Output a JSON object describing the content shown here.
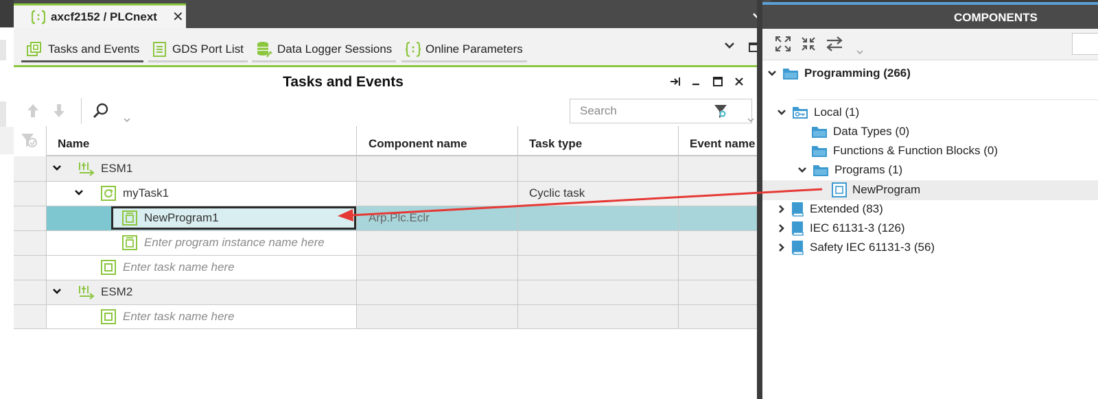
{
  "doc_tab": {
    "title": "axcf2152 / PLCnext",
    "close": "✕"
  },
  "subtabs": [
    {
      "label": "Tasks and Events"
    },
    {
      "label": "GDS Port List"
    },
    {
      "label": "Data Logger Sessions"
    },
    {
      "label": "Online Parameters"
    }
  ],
  "panel": {
    "title": "Tasks and Events"
  },
  "search": {
    "placeholder": "Search"
  },
  "table": {
    "columns": [
      "Name",
      "Component name",
      "Task type",
      "Event name"
    ],
    "rows": [
      {
        "name": "ESM1",
        "component": "",
        "task_type": "",
        "event": ""
      },
      {
        "name": "myTask1",
        "component": "",
        "task_type": "Cyclic task",
        "event": ""
      },
      {
        "name": "NewProgram1",
        "component": "Arp.Plc.Eclr",
        "task_type": "",
        "event": ""
      },
      {
        "name": "Enter program instance name here",
        "component": "",
        "task_type": "",
        "event": ""
      },
      {
        "name": "Enter task name here",
        "component": "",
        "task_type": "",
        "event": ""
      },
      {
        "name": "ESM2",
        "component": "",
        "task_type": "",
        "event": ""
      },
      {
        "name": "Enter task name here",
        "component": "",
        "task_type": "",
        "event": ""
      }
    ]
  },
  "components": {
    "header": "COMPONENTS",
    "tree": [
      {
        "label": "Programming (266)"
      },
      {
        "label": "Local (1)"
      },
      {
        "label": "Data Types (0)"
      },
      {
        "label": "Functions & Function Blocks (0)"
      },
      {
        "label": "Programs (1)"
      },
      {
        "label": "NewProgram"
      },
      {
        "label": "Extended (83)"
      },
      {
        "label": "IEC 61131-3 (126)"
      },
      {
        "label": "Safety IEC 61131-3 (56)"
      }
    ]
  },
  "colors": {
    "accent_green": "#8cc63f",
    "selected_row": "#a8d5da",
    "arrow": "#e53935",
    "folder_blue": "#3d9ad1"
  }
}
